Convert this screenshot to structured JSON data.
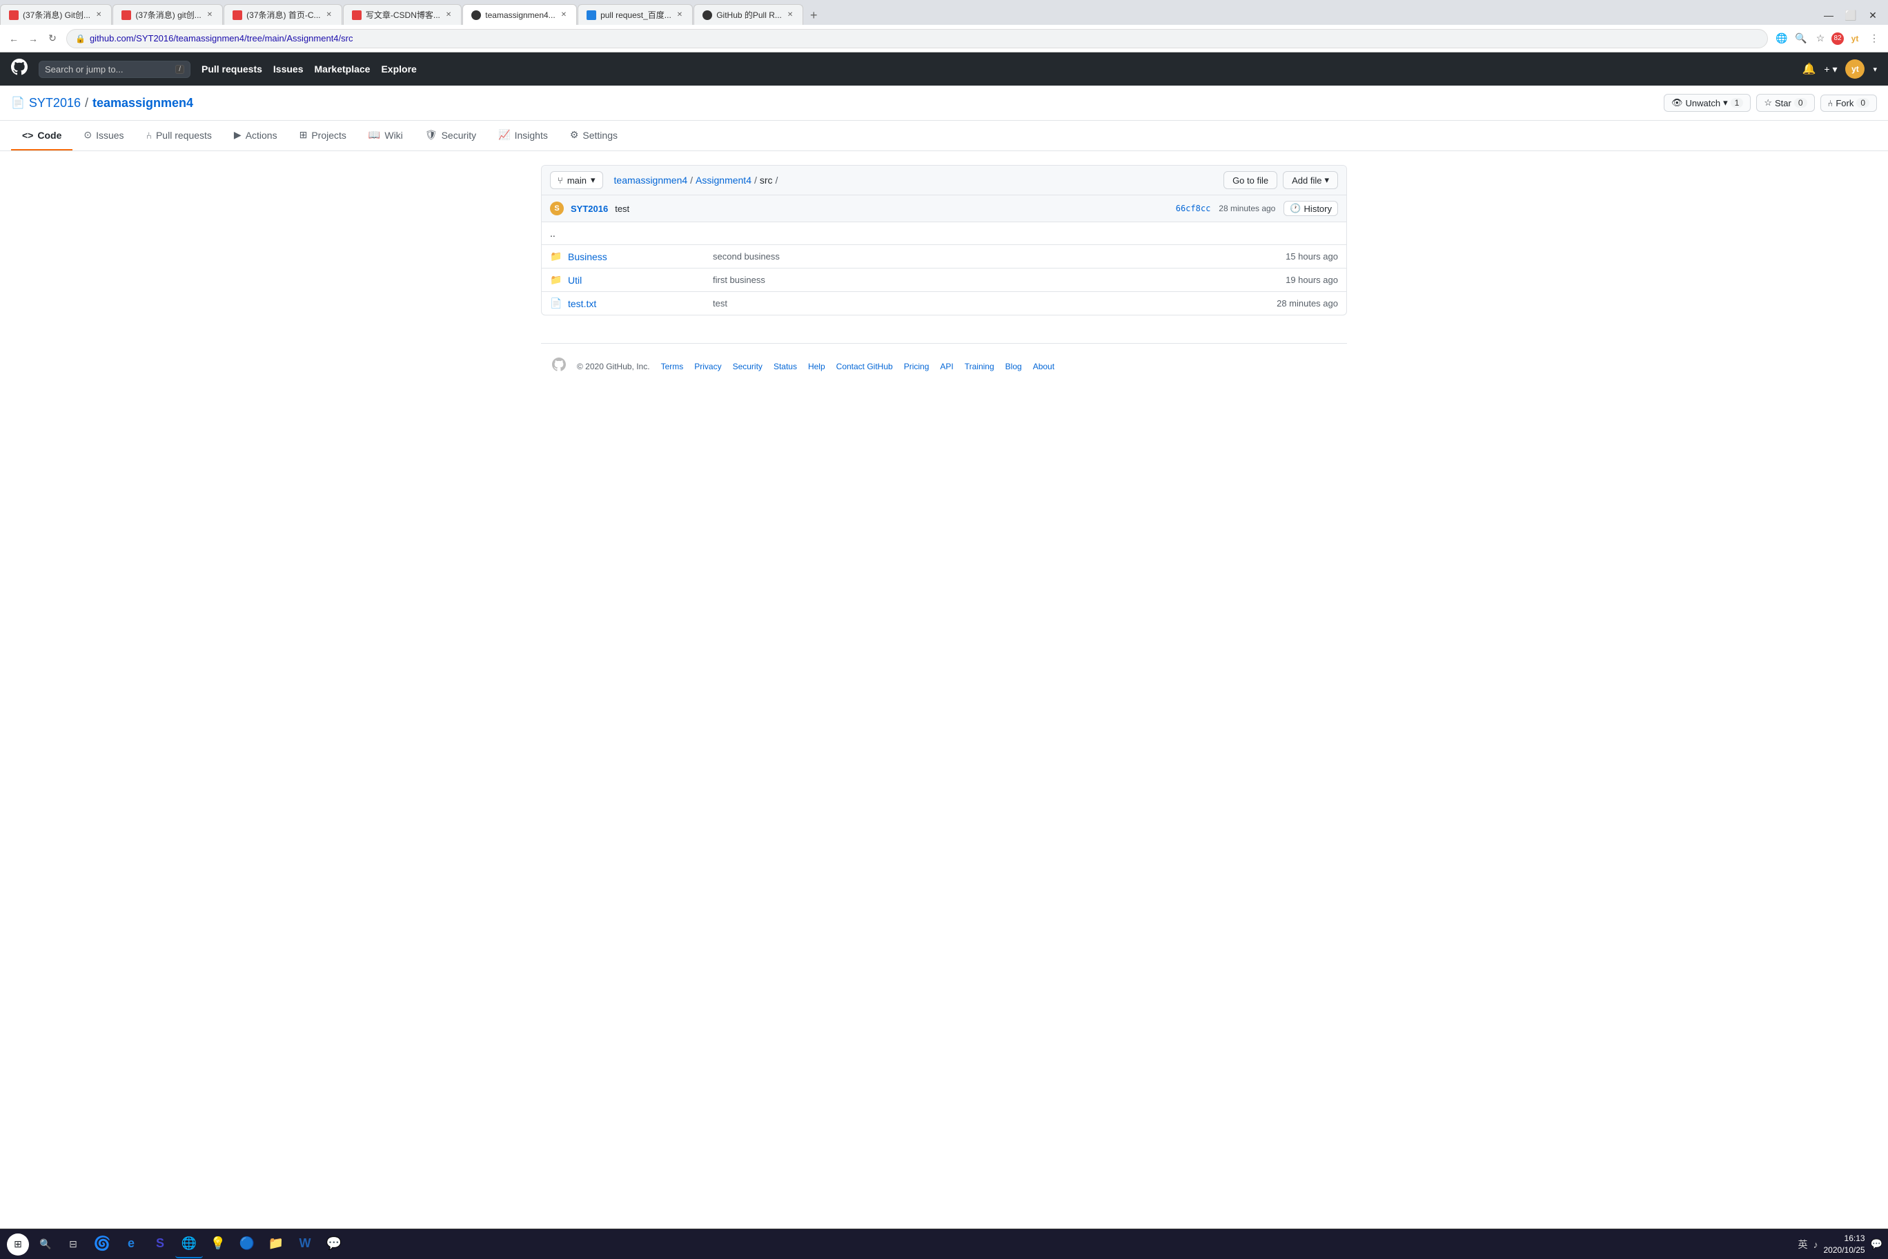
{
  "browser": {
    "tabs": [
      {
        "id": 1,
        "favicon_color": "red",
        "label": "(37条消息) Git创...",
        "active": false
      },
      {
        "id": 2,
        "favicon_color": "red",
        "label": "(37条消息) git创...",
        "active": false
      },
      {
        "id": 3,
        "favicon_color": "red",
        "label": "(37条消息) 首页-C...",
        "active": false
      },
      {
        "id": 4,
        "favicon_color": "red",
        "label": "写文章-CSDN博客...",
        "active": false
      },
      {
        "id": 5,
        "favicon_color": "github",
        "label": "teamassignmen4...",
        "active": true
      },
      {
        "id": 6,
        "favicon_color": "baidu",
        "label": "pull request_百度...",
        "active": false
      },
      {
        "id": 7,
        "favicon_color": "github",
        "label": "GitHub 的Pull R...",
        "active": false
      }
    ],
    "badge_count": "82",
    "url": "github.com/SYT2016/teamassignmen4/tree/main/Assignment4/src"
  },
  "github": {
    "nav": {
      "search_placeholder": "Search or jump to...",
      "items": [
        "Pull requests",
        "Issues",
        "Marketplace",
        "Explore"
      ]
    },
    "repo": {
      "owner": "SYT2016",
      "name": "teamassignmen4",
      "watch_label": "Unwatch",
      "watch_count": "1",
      "star_label": "Star",
      "star_count": "0",
      "fork_label": "Fork",
      "fork_count": "0"
    },
    "repo_tabs": [
      {
        "id": "code",
        "label": "Code",
        "active": true
      },
      {
        "id": "issues",
        "label": "Issues",
        "active": false
      },
      {
        "id": "pull-requests",
        "label": "Pull requests",
        "active": false
      },
      {
        "id": "actions",
        "label": "Actions",
        "active": false
      },
      {
        "id": "projects",
        "label": "Projects",
        "active": false
      },
      {
        "id": "wiki",
        "label": "Wiki",
        "active": false
      },
      {
        "id": "security",
        "label": "Security",
        "active": false
      },
      {
        "id": "insights",
        "label": "Insights",
        "active": false
      },
      {
        "id": "settings",
        "label": "Settings",
        "active": false
      }
    ],
    "file_browser": {
      "branch": "main",
      "path": [
        {
          "label": "teamassignmen4",
          "link": true
        },
        {
          "label": "Assignment4",
          "link": true
        },
        {
          "label": "src",
          "link": false
        },
        {
          "label": "/",
          "link": false
        }
      ],
      "goto_file_label": "Go to file",
      "add_file_label": "Add file",
      "commit": {
        "author": "SYT2016",
        "message": "test",
        "hash": "66cf8cc",
        "time": "28 minutes ago",
        "history_label": "History"
      },
      "dotdot": "..",
      "files": [
        {
          "type": "folder",
          "name": "Business",
          "message": "second business",
          "time": "15 hours ago"
        },
        {
          "type": "folder",
          "name": "Util",
          "message": "first business",
          "time": "19 hours ago"
        },
        {
          "type": "file",
          "name": "test.txt",
          "message": "test",
          "time": "28 minutes ago"
        }
      ]
    },
    "footer": {
      "copyright": "© 2020 GitHub, Inc.",
      "links": [
        "Terms",
        "Privacy",
        "Security",
        "Status",
        "Help",
        "Contact GitHub",
        "Pricing",
        "API",
        "Training",
        "Blog",
        "About"
      ]
    }
  },
  "taskbar": {
    "time": "16:13",
    "date": "2020/10/25"
  }
}
